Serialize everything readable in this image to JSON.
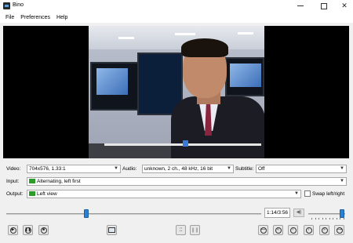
{
  "window": {
    "title": "Bino"
  },
  "menu": [
    "File",
    "Preferences",
    "Help"
  ],
  "video": {
    "label": "Video:",
    "value": "704x576, 1.33:1"
  },
  "audio": {
    "label": "Audio:",
    "value": "unknown, 2 ch., 48 kHz, 16 bit"
  },
  "subtitle": {
    "label": "Subtitle:",
    "value": "Off"
  },
  "input": {
    "label": "Input:",
    "value": "Alternating, left first"
  },
  "output": {
    "label": "Output:",
    "value": "Left view"
  },
  "swap": {
    "label": "Swap left/right",
    "checked": false
  },
  "playback": {
    "time": "1:14/3:56",
    "position_fraction": 0.31,
    "volume_fraction": 0.98
  },
  "colors": {
    "accent": "#2d7fd1",
    "swatch": "#2a9d2a"
  },
  "icons": [
    "play-icon",
    "pause-icon",
    "stop-icon",
    "fullscreen-icon",
    "center-icon",
    "loop-icon",
    "mute-icon",
    "seek-back-far-icon",
    "seek-back-icon",
    "seek-back-short-icon",
    "seek-forward-short-icon",
    "seek-forward-icon",
    "seek-forward-far-icon"
  ]
}
